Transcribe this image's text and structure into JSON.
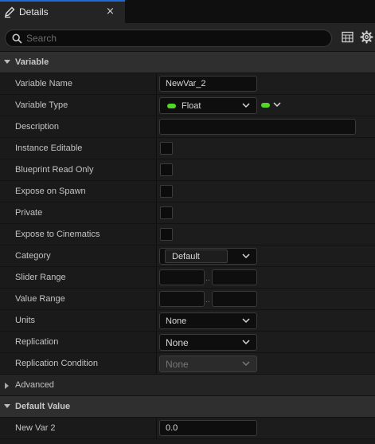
{
  "tab": {
    "title": "Details",
    "close": "×"
  },
  "search": {
    "placeholder": "Search",
    "value": ""
  },
  "sections": {
    "variable": "Variable",
    "default_value": "Default Value"
  },
  "properties": {
    "variable_name": {
      "label": "Variable Name",
      "value": "NewVar_2"
    },
    "variable_type": {
      "label": "Variable Type",
      "value": "Float",
      "pin_color": "#53d62a"
    },
    "description": {
      "label": "Description",
      "value": ""
    },
    "instance_editable": {
      "label": "Instance Editable",
      "checked": false
    },
    "blueprint_read_only": {
      "label": "Blueprint Read Only",
      "checked": false
    },
    "expose_on_spawn": {
      "label": "Expose on Spawn",
      "checked": false
    },
    "private": {
      "label": "Private",
      "checked": false
    },
    "expose_to_cinematics": {
      "label": "Expose to Cinematics",
      "checked": false
    },
    "category": {
      "label": "Category",
      "value": "Default"
    },
    "slider_range": {
      "label": "Slider Range",
      "min": "",
      "max": "",
      "sep": ".."
    },
    "value_range": {
      "label": "Value Range",
      "min": "",
      "max": "",
      "sep": ".."
    },
    "units": {
      "label": "Units",
      "value": "None"
    },
    "replication": {
      "label": "Replication",
      "value": "None"
    },
    "replication_condition": {
      "label": "Replication Condition",
      "value": "None",
      "disabled": true
    },
    "advanced": {
      "label": "Advanced"
    },
    "new_var_2": {
      "label": "New Var 2",
      "value": "0.0"
    }
  }
}
